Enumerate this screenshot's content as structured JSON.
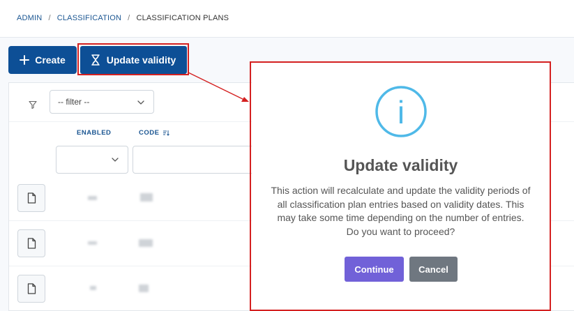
{
  "breadcrumb": {
    "items": [
      "ADMIN",
      "CLASSIFICATION"
    ],
    "separator": "/",
    "current": "CLASSIFICATION PLANS"
  },
  "toolbar": {
    "create_label": "Create",
    "update_validity_label": "Update validity"
  },
  "filter": {
    "selected": "-- filter --"
  },
  "table": {
    "columns": [
      "ENABLED",
      "CODE"
    ],
    "rows": 3
  },
  "modal": {
    "icon": "info-icon",
    "icon_letter": "i",
    "title": "Update validity",
    "message": "This action will recalculate and update the validity periods of all classification plan entries based on validity dates. This may take some time depending on the number of entries. Do you want to proceed?",
    "continue_label": "Continue",
    "cancel_label": "Cancel"
  },
  "colors": {
    "primary": "#0d4f96",
    "annotation": "#d42020",
    "continue": "#7161d8",
    "cancel": "#6f7780",
    "info": "#4fb9e8"
  }
}
